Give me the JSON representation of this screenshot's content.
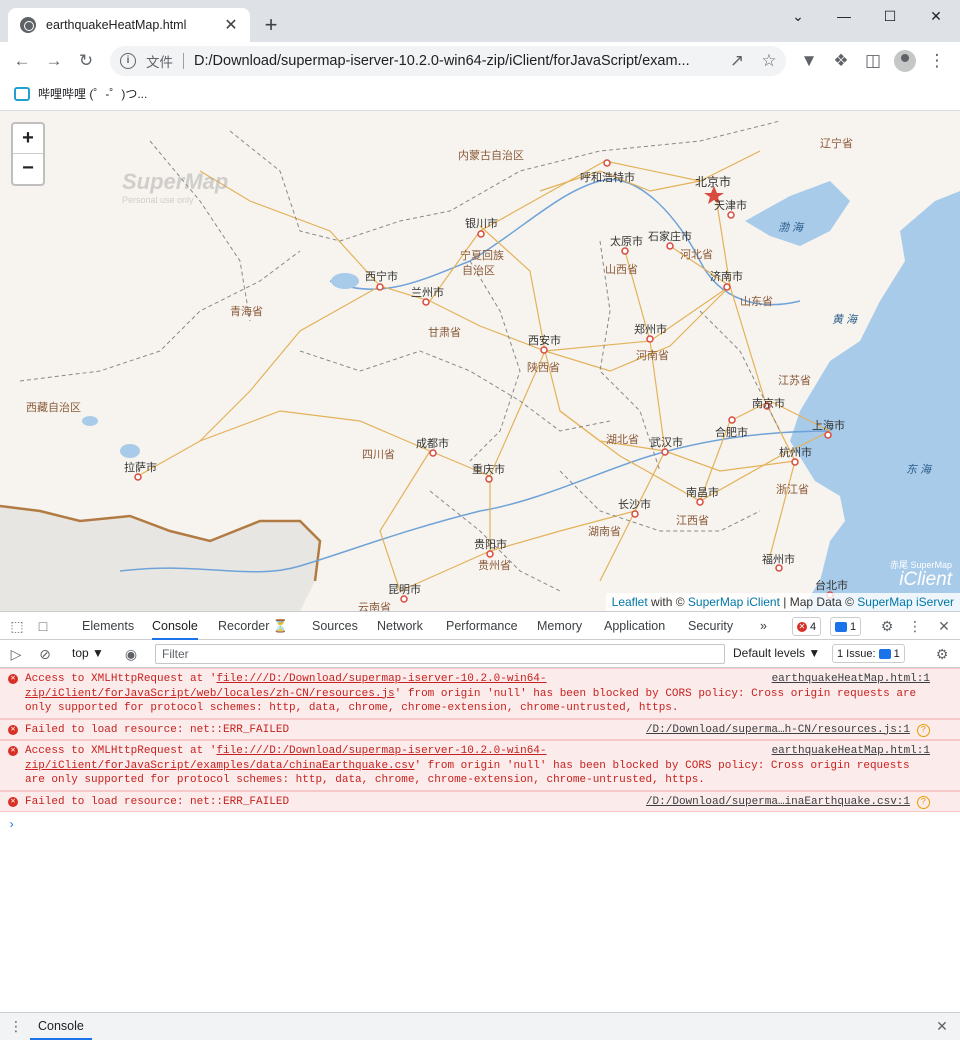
{
  "tab": {
    "title": "earthquakeHeatMap.html",
    "close": "✕",
    "new": "+"
  },
  "window": {
    "dropdown": "⌄",
    "minimize": "—",
    "maximize": "☐",
    "close": "✕"
  },
  "toolbar": {
    "scheme_label": "文件",
    "url": "D:/Download/supermap-iserver-10.2.0-win64-zip/iClient/forJavaScript/exam..."
  },
  "bookmarks": [
    {
      "label": "哔哩哔哩 (゜-゜)つ..."
    }
  ],
  "map": {
    "labels": {
      "neimenggu": "内蒙古自治区",
      "huhehaote": "呼和浩特市",
      "beijing": "北京市",
      "tianjin": "天津市",
      "liaoning": "辽宁省",
      "yinchuan": "银川市",
      "ningxia1": "宁夏回族",
      "ningxia2": "自治区",
      "taiyuan": "太原市",
      "shijiazhuang": "石家庄市",
      "shanxi": "山西省",
      "hebei": "河北省",
      "xining": "西宁市",
      "lanzhou": "兰州市",
      "jinan": "济南市",
      "shandong": "山东省",
      "qinghai": "青海省",
      "gansu": "甘肃省",
      "zhengzhou": "郑州市",
      "henan": "河南省",
      "xian": "西安市",
      "shaanxi": "陕西省",
      "xizang": "西藏自治区",
      "jiangsu": "江苏省",
      "nanjing": "南京市",
      "hefei": "合肥市",
      "shanghai": "上海市",
      "chengdu": "成都市",
      "sichuan": "四川省",
      "hubei": "湖北省",
      "wuhan": "武汉市",
      "hangzhou": "杭州市",
      "lasa": "拉萨市",
      "chongqing": "重庆市",
      "nanchang": "南昌市",
      "zhejiang": "浙江省",
      "changsha": "长沙市",
      "jiangxi": "江西省",
      "guiyang": "贵阳市",
      "hunan": "湖南省",
      "guizhou": "贵州省",
      "fuzhou": "福州市",
      "kunming": "昆明市",
      "yunnan": "云南省",
      "taibei": "台北市",
      "bohai": "渤 海",
      "huanghai": "黄 海",
      "donghai": "东 海"
    },
    "watermark": "SuperMap",
    "watermark_sub": "Personal use only",
    "logo_top": "赤尾 SuperMap",
    "logo_main": "iClient",
    "attribution": {
      "leaflet": "Leaflet",
      "with": "with ©",
      "iclient": "SuperMap iClient",
      "sep": "| Map Data ©",
      "iserver": "SuperMap iServer"
    }
  },
  "devtools": {
    "tabs": [
      "Elements",
      "Console",
      "Recorder",
      "Sources",
      "Network",
      "Performance",
      "Memory",
      "Application",
      "Security"
    ],
    "recorder_suffix": "⏳",
    "more": "»",
    "error_count": "4",
    "message_count": "1",
    "context": "top ▼",
    "filter_placeholder": "Filter",
    "levels": "Default levels ▼",
    "issues": "1 Issue:",
    "issues_count": "1",
    "messages": [
      {
        "pre": "Access to XMLHttpRequest at '",
        "link": "file:///D:/Download/supermap-iserver-10.2.0-win64-zip/iClient/forJavaScript/web/locales/zh-CN/resources.js",
        "post": "' from origin 'null' has been blocked by CORS policy: Cross origin requests are only supported for protocol schemes: http, data, chrome, chrome-extension, chrome-untrusted, https.",
        "source": "earthquakeHeatMap.html:1"
      },
      {
        "pre": "Failed to load resource: net::ERR_FAILED",
        "link": "",
        "post": "",
        "source": "/D:/Download/superma…h-CN/resources.js:1"
      },
      {
        "pre": "Access to XMLHttpRequest at '",
        "link": "file:///D:/Download/supermap-iserver-10.2.0-win64-zip/iClient/forJavaScript/examples/data/chinaEarthquake.csv",
        "post": "' from origin 'null' has been blocked by CORS policy: Cross origin requests are only supported for protocol schemes: http, data, chrome, chrome-extension, chrome-untrusted, https.",
        "source": "earthquakeHeatMap.html:1"
      },
      {
        "pre": "Failed to load resource: net::ERR_FAILED",
        "link": "",
        "post": "",
        "source": "/D:/Download/superma…inaEarthquake.csv:1"
      }
    ],
    "prompt": "›",
    "drawer_tab": "Console"
  }
}
